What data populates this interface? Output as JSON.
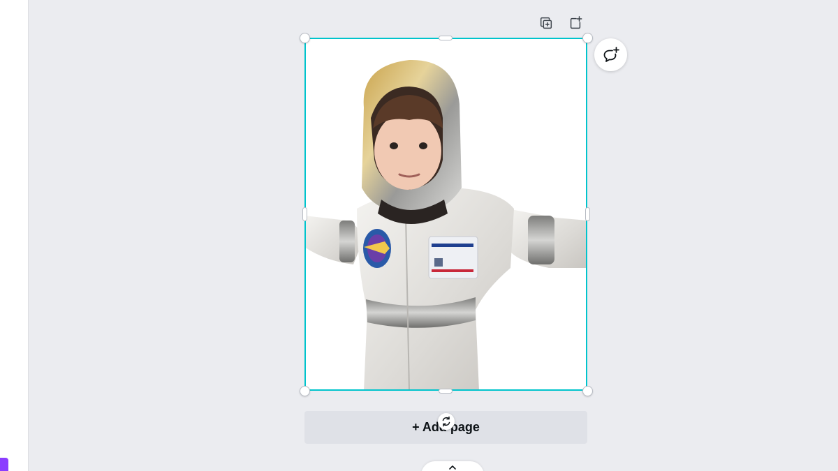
{
  "toolbar": {
    "duplicate_icon": "duplicate-page-icon",
    "add_page_icon": "add-page-icon"
  },
  "comment": {
    "icon": "add-comment-icon"
  },
  "canvas": {
    "image_subject": "child-in-astronaut-costume-photo",
    "selection_color": "#00c4cc"
  },
  "add_page_button": {
    "label": "+ Add page"
  },
  "rotate": {
    "icon": "rotate-icon"
  },
  "bottom_bar": {
    "icon": "chevron-up-icon"
  },
  "colors": {
    "background": "#ebecf0",
    "accent": "#00c4cc",
    "brand_purple": "#8b3dff",
    "add_page_bg": "#dfe1e7"
  }
}
